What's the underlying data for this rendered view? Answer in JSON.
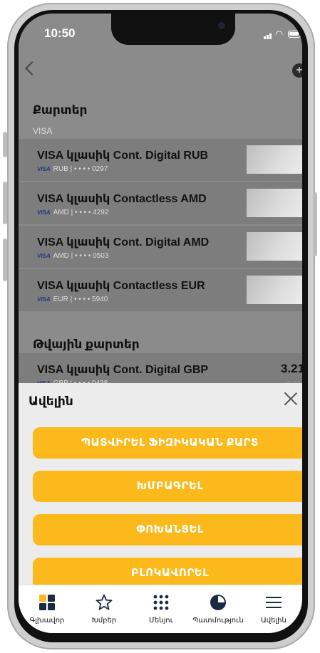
{
  "status": {
    "time": "10:50"
  },
  "sections": {
    "cards_title": "Քարտեր",
    "visa_subhead": "VISA",
    "virtual_title": "Թվային քարտեր"
  },
  "cards": [
    {
      "name": "VISA կլասիկ Cont. Digital RUB",
      "brand": "VISA",
      "meta": "RUB | • • • • 0297"
    },
    {
      "name": "VISA կլասիկ Contactless AMD",
      "brand": "VISA",
      "meta": "AMD | • • • • 4292"
    },
    {
      "name": "VISA կլասիկ Cont. Digital AMD",
      "brand": "VISA",
      "meta": "AMD | • • • • 0503"
    },
    {
      "name": "VISA կլասիկ Contactless  EUR",
      "brand": "VISA",
      "meta": "EUR | • • • • 5940"
    }
  ],
  "virtual_card": {
    "name": "VISA կլասիկ Cont. Digital GBP",
    "brand": "VISA",
    "meta": "GBP | • • • • 0438",
    "balance": "3.21",
    "balance_secondary": "3.21"
  },
  "sheet": {
    "title": "Ավելին",
    "actions": [
      "ՊԱՏՎԻՐԵԼ ՖԻԶԻԿԱԿԱՆ ՔԱՐՏ",
      "ԽՄԲԱԳՐԵԼ",
      "ՓՈԽԱՆՑԵԼ",
      "ԲԼՈԿԱՎՈՐԵԼ"
    ]
  },
  "tabs": [
    {
      "label": "Գլխավոր",
      "icon": "home-grid-icon"
    },
    {
      "label": "Խմբեր",
      "icon": "star-icon"
    },
    {
      "label": "Մենյու",
      "icon": "dots-grid-icon"
    },
    {
      "label": "Պատմություն",
      "icon": "history-pie-icon"
    },
    {
      "label": "Ավելին",
      "icon": "menu-lines-icon"
    }
  ],
  "colors": {
    "accent": "#fbb91c",
    "overlay": "#8b8b8b",
    "sheet": "#ececec"
  }
}
